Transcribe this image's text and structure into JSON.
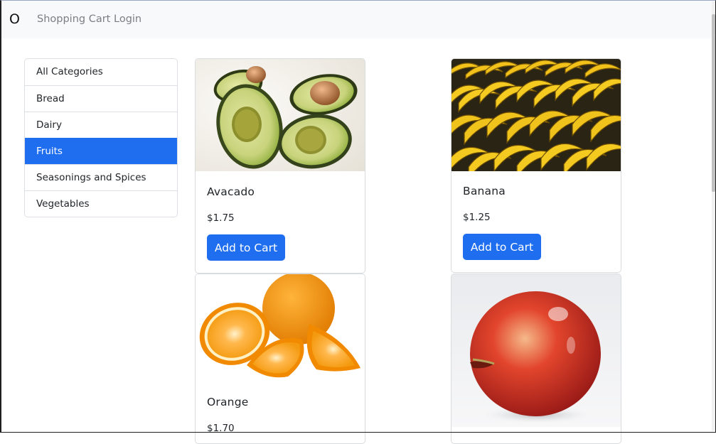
{
  "navbar": {
    "brand": "O",
    "links": {
      "cart": "Shopping Cart",
      "login": "Login"
    }
  },
  "categories": {
    "items": [
      {
        "label": "All Categories",
        "active": false
      },
      {
        "label": "Bread",
        "active": false
      },
      {
        "label": "Dairy",
        "active": false
      },
      {
        "label": "Fruits",
        "active": true
      },
      {
        "label": "Seasonings and Spices",
        "active": false
      },
      {
        "label": "Vegetables",
        "active": false
      }
    ]
  },
  "products": {
    "avocado": {
      "name": "Avacado",
      "price": "$1.75",
      "button": "Add to Cart",
      "image": "avocado-image"
    },
    "banana": {
      "name": "Banana",
      "price": "$1.25",
      "button": "Add to Cart",
      "image": "banana-image"
    },
    "orange": {
      "name": "Orange",
      "price": "$1.70",
      "image": "orange-image"
    },
    "apple": {
      "image": "apple-image"
    }
  },
  "colors": {
    "primary": "#1f6ef0",
    "navbar_bg": "#f8f9fa",
    "nav_link": "#7a7f85"
  }
}
